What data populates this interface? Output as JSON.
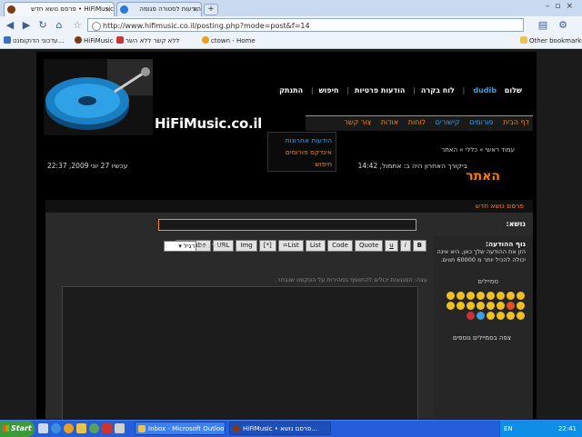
{
  "browser": {
    "tabs": [
      {
        "label": "HiFiMusic • פרסם נושא חדש",
        "active": true
      },
      {
        "label": "הודעות לסטורה פגומה",
        "active": false
      }
    ],
    "new_tab": "+",
    "url": "http://www.hifimusic.co.il/posting.php?mode=post&f=14",
    "bookmarks": [
      {
        "label": "עדכוני הדוקומנט..."
      },
      {
        "label": "HiFiMusic"
      },
      {
        "label": "ללא קשר ללא השר"
      },
      {
        "label": "ctown - Home"
      }
    ],
    "other_bookmarks": "Other bookmarks"
  },
  "site": {
    "brand": "HiFiMusic.co.il",
    "greeting": "שלום",
    "username": "dudib",
    "top_links": [
      "לוח בקרה",
      "הודעות פרטיות",
      "חיפוש",
      "התנתק"
    ],
    "nav": [
      "דף הבית",
      "פורומים",
      "קישורים",
      "לוחות",
      "אודות",
      "צור קשר"
    ],
    "dropdown": [
      "הודעות אחרונות",
      "אינדקס פורומים",
      "חיפוש"
    ],
    "breadcrumb": "עמוד ראשי » כללי » האתר",
    "last_visit": "ביקורך האחרון היה ב: אתמול, 14:42",
    "current_date": "עכשיו 27 יוני 2009, 22:37",
    "forum_name": "האתר"
  },
  "form": {
    "header": "פרסם נושא חדש",
    "subject_label": "נושא:",
    "body_label": "גוף ההודעה:",
    "body_help": "הזן את ההודעה שלך כאן, היא אינה יכולה להכיל יותר מ 60000 תווים.",
    "smilies_label": "סמיילים",
    "more_smilies": "צפה בסמיילים נוספים",
    "buttons": [
      "B",
      "i",
      "u",
      "Quote",
      "Code",
      "List",
      "List=",
      "[*]",
      "Img",
      "URL",
      "youtube"
    ],
    "font_size_label": "גודל גופן:",
    "font_size_value": "רגיל",
    "hint": "עצה: הסגנונות יכולים להתווסף במהירות על הטקסט שנבחר."
  },
  "taskbar": {
    "start": "Start",
    "tasks": [
      {
        "label": "Inbox - Microsoft Outlook",
        "active": false
      },
      {
        "label": "HiFiMusic • פרסם נושא...",
        "active": true
      }
    ],
    "lang": "EN",
    "clock": "22:41"
  },
  "colors": {
    "accent_orange": "#ff7a00",
    "accent_blue": "#3aa0e0",
    "page_bg": "#000000",
    "taskbar_blue": "#245edb"
  }
}
